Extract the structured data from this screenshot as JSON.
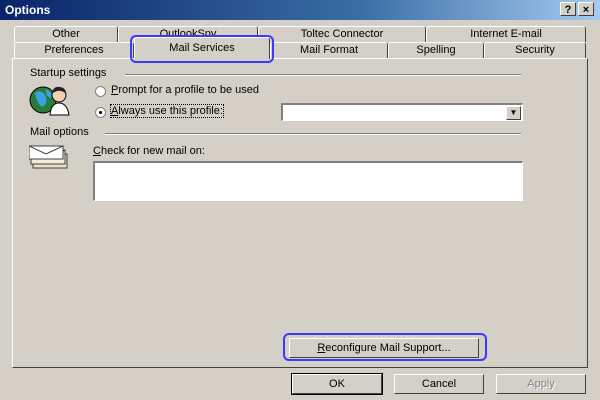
{
  "window": {
    "title": "Options",
    "help_button": "?",
    "close_button": "×"
  },
  "tabs": {
    "row_back": [
      {
        "label": "Other"
      },
      {
        "label": "OutlookSpy"
      },
      {
        "label": "Toltec Connector"
      },
      {
        "label": "Internet E-mail"
      }
    ],
    "row_front": [
      {
        "label": "Preferences"
      },
      {
        "label": "Mail Services",
        "selected": true
      },
      {
        "label": "Mail Format"
      },
      {
        "label": "Spelling"
      },
      {
        "label": "Security"
      }
    ]
  },
  "startup": {
    "heading": "Startup settings",
    "icon": "profile-globe-icon",
    "option_prompt": {
      "prefix": "",
      "accel": "P",
      "rest": "rompt for a profile to be used",
      "checked": false
    },
    "option_always": {
      "prefix": "",
      "accel": "A",
      "rest": "lways use this profile:",
      "checked": true
    },
    "profile_value": ""
  },
  "mail_options": {
    "heading": "Mail options",
    "icon": "envelope-stack-icon",
    "check_label": {
      "prefix": "",
      "accel": "C",
      "rest": "heck for new mail on:"
    }
  },
  "reconfigure": {
    "accel": "R",
    "rest": "econfigure Mail Support..."
  },
  "buttons": {
    "ok": "OK",
    "cancel": "Cancel",
    "apply": "Apply"
  },
  "colors": {
    "title_start": "#0a246a",
    "title_end": "#a6caf0",
    "face": "#d4d0c8",
    "highlight_ring": "#3a3aff"
  }
}
